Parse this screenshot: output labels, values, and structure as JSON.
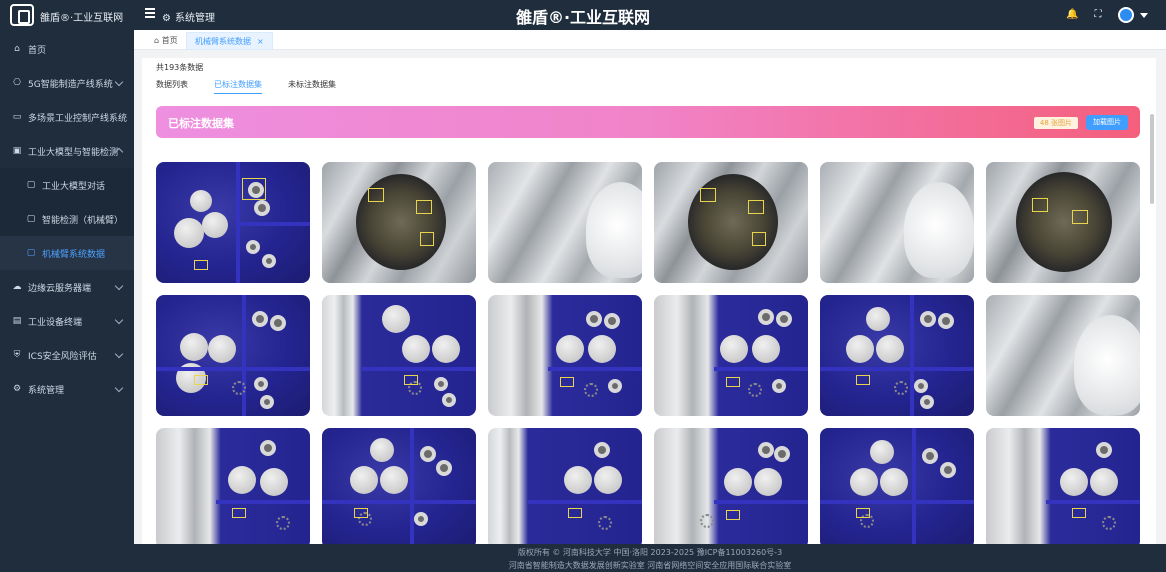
{
  "topbar": {
    "logo_text": "雒盾®·工业互联网",
    "breadcrumb": "系统管理",
    "center_title": "雒盾®·工业互联网"
  },
  "sidebar": {
    "items": [
      {
        "label": "首页",
        "icon": "home-icon"
      },
      {
        "label": "5G智能制造产线系统",
        "icon": "network-icon"
      },
      {
        "label": "多场景工业控制产线系统",
        "icon": "monitor-icon"
      },
      {
        "label": "工业大模型与智能检测",
        "icon": "layout-icon"
      },
      {
        "label": "工业大模型对话",
        "icon": "chat-icon"
      },
      {
        "label": "智能检测（机械臂）",
        "icon": "robot-icon"
      },
      {
        "label": "机械臂系统数据",
        "icon": "data-icon"
      },
      {
        "label": "边缘云服务器端",
        "icon": "cloud-icon"
      },
      {
        "label": "工业设备终端",
        "icon": "device-icon"
      },
      {
        "label": "ICS安全风险评估",
        "icon": "shield-icon"
      },
      {
        "label": "系统管理",
        "icon": "gear-icon"
      }
    ]
  },
  "tabs": {
    "home": "首页",
    "active": "机械臂系统数据"
  },
  "panel": {
    "count_text": "共193条数据",
    "subtabs": [
      "数据列表",
      "已标注数据集",
      "未标注数据集"
    ],
    "banner_title": "已标注数据集",
    "badge": "48 张图片",
    "load_button": "加载图片"
  },
  "footer": {
    "line1": "版权所有 © 河南科技大学  中国·洛阳  2023-2025     豫ICP备11003260号-3",
    "line2": "河南省智能制造大数据发展创新实验室  河南省网络空间安全应用国际联合实验室"
  },
  "colors": {
    "sidebar_bg": "#1f2d3d",
    "accent": "#409eff",
    "banner_start": "#ee8fe0",
    "banner_end": "#f45f7c"
  }
}
